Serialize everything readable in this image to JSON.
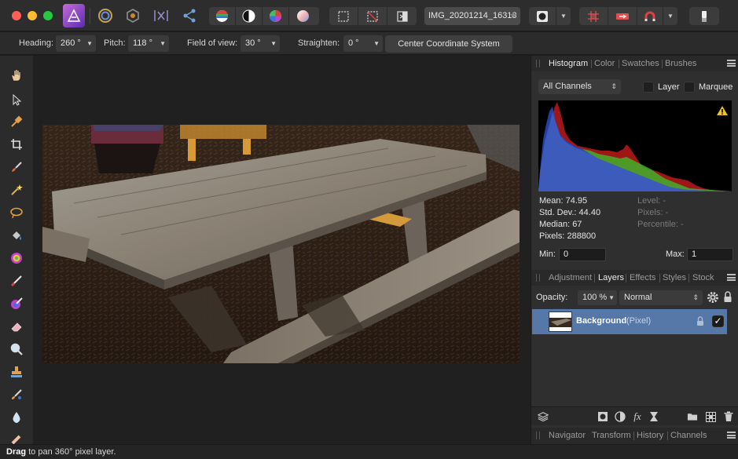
{
  "toolbar": {
    "traffic_lights": {
      "close": "#ff5f57",
      "minimize": "#febc2e",
      "zoom": "#28c840"
    },
    "app_icon": "affinity-photo-icon",
    "personas": [
      "photo-persona-icon",
      "liquify-persona-icon",
      "develop-persona-icon",
      "tone-map-persona-icon",
      "export-persona-icon"
    ],
    "adjust_icons": [
      "auto-levels-icon",
      "auto-contrast-icon",
      "auto-colors-icon",
      "auto-white-balance-icon"
    ],
    "selection_icons": [
      "marquee-selection-icon",
      "clear-selection-icon",
      "invert-selection-icon"
    ],
    "document_tab": {
      "label": "IMG_20201214_16313",
      "star": "★"
    },
    "right_icons": [
      "quick-mask-icon",
      "grid-icon",
      "assistant-icon",
      "snapping-magnet-icon",
      "erase-icon"
    ]
  },
  "context": {
    "heading_label": "Heading:",
    "heading_value": "260 °",
    "pitch_label": "Pitch:",
    "pitch_value": "118 °",
    "fov_label": "Field of view:",
    "fov_value": "30 °",
    "straighten_label": "Straighten:",
    "straighten_value": "0 °",
    "center_button": "Center Coordinate System"
  },
  "tools": [
    "hand-tool-icon",
    "move-tool-icon",
    "color-picker-icon",
    "crop-tool-icon",
    "paint-brush-icon",
    "magic-wand-icon",
    "freehand-selection-icon",
    "flood-fill-icon",
    "gradient-tool-icon",
    "pixel-tool-icon",
    "color-replacement-icon",
    "eraser-icon",
    "zoom-tool-icon",
    "clone-stamp-icon",
    "inpainting-brush-icon",
    "blur-brush-icon",
    "dodge-brush-icon"
  ],
  "histogram_panel": {
    "tabs": [
      "Histogram",
      "Color",
      "Swatches",
      "Brushes"
    ],
    "active_tab": "Histogram",
    "channel_select": "All Channels",
    "layer_label": "Layer",
    "marquee_label": "Marquee",
    "warning_icon": "warning-icon",
    "stats": {
      "mean": "Mean: 74.95",
      "std_dev": "Std. Dev.: 44.40",
      "median": "Median: 67",
      "pixels": "Pixels: 288800",
      "level": "Level: -",
      "pixels_right": "Pixels: -",
      "percentile": "Percentile: -"
    },
    "min_label": "Min:",
    "min_value": "0",
    "max_label": "Max:",
    "max_value": "1"
  },
  "layers_panel": {
    "tabs": [
      "Adjustment",
      "Layers",
      "Effects",
      "Styles",
      "Stock"
    ],
    "active_tab": "Layers",
    "opacity_label": "Opacity:",
    "opacity_value": "100 %",
    "blend_mode": "Normal",
    "layer": {
      "name": "Background",
      "kind": "(Pixel)",
      "visible": "✓"
    },
    "footer_icons": [
      "layer-stack-icon",
      "mask-icon",
      "adjustment-icon",
      "fx-icon",
      "live-filter-icon",
      "group-folder-icon",
      "add-pixel-layer-icon",
      "trash-icon"
    ]
  },
  "bottom_panel": {
    "tabs": [
      "Navigator",
      "Transform",
      "History",
      "Channels"
    ]
  },
  "status": {
    "bold": "Drag",
    "text": " to pan 360° pixel layer."
  }
}
